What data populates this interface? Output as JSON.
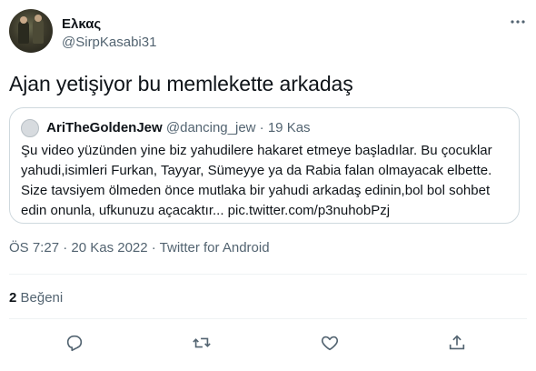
{
  "author": {
    "display_name": "Ελκας",
    "handle": "@SirpKasabi31"
  },
  "tweet": {
    "text": "Ajan yetişiyor bu memlekette arkadaş",
    "timestamp": "ÖS 7:27 · 20 Kas 2022 · Twitter for Android"
  },
  "quote": {
    "display_name": "AriTheGoldenJew",
    "handle": "@dancing_jew",
    "separator": "·",
    "date": "19 Kas",
    "lines": [
      "Şu video yüzünden yine biz yahudilere hakaret etmeye başladılar. Bu çocuklar",
      "yahudi,isimleri Furkan, Tayyar, Sümeyye ya da Rabia falan olmayacak elbette.",
      "Size tavsiyem ölmeden önce mutlaka bir yahudi arkadaş edinin,bol bol sohbet",
      "edin onunla, ufkunuzu açacaktır... pic.twitter.com/p3nuhobPzj"
    ]
  },
  "stats": {
    "likes_count": "2",
    "likes_label": "Beğeni"
  },
  "icons": {
    "more": "more-icon",
    "reply": "reply-icon",
    "retweet": "retweet-icon",
    "like": "like-icon",
    "share": "share-icon"
  },
  "colors": {
    "text": "#0f1419",
    "secondary": "#536471",
    "border": "#cfd9de",
    "divider": "#eff3f4"
  }
}
